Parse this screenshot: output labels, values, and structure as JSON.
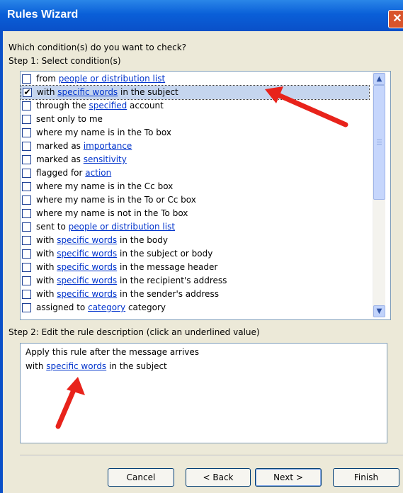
{
  "window": {
    "title": "Rules Wizard",
    "close_glyph": "✕"
  },
  "question": "Which condition(s) do you want to check?",
  "step1_label": "Step 1: Select condition(s)",
  "conditions": [
    {
      "checked": false,
      "prefix": "from ",
      "link": "people or distribution list",
      "suffix": ""
    },
    {
      "checked": true,
      "prefix": "with ",
      "link": "specific words",
      "suffix": " in the subject",
      "selected": true
    },
    {
      "checked": false,
      "prefix": "through the ",
      "link": "specified",
      "suffix": " account"
    },
    {
      "checked": false,
      "prefix": "sent only to me",
      "link": "",
      "suffix": ""
    },
    {
      "checked": false,
      "prefix": "where my name is in the To box",
      "link": "",
      "suffix": ""
    },
    {
      "checked": false,
      "prefix": "marked as ",
      "link": "importance",
      "suffix": ""
    },
    {
      "checked": false,
      "prefix": "marked as ",
      "link": "sensitivity",
      "suffix": ""
    },
    {
      "checked": false,
      "prefix": "flagged for ",
      "link": "action",
      "suffix": ""
    },
    {
      "checked": false,
      "prefix": "where my name is in the Cc box",
      "link": "",
      "suffix": ""
    },
    {
      "checked": false,
      "prefix": "where my name is in the To or Cc box",
      "link": "",
      "suffix": ""
    },
    {
      "checked": false,
      "prefix": "where my name is not in the To box",
      "link": "",
      "suffix": ""
    },
    {
      "checked": false,
      "prefix": "sent to ",
      "link": "people or distribution list",
      "suffix": ""
    },
    {
      "checked": false,
      "prefix": "with ",
      "link": "specific words",
      "suffix": " in the body"
    },
    {
      "checked": false,
      "prefix": "with ",
      "link": "specific words",
      "suffix": " in the subject or body"
    },
    {
      "checked": false,
      "prefix": "with ",
      "link": "specific words",
      "suffix": " in the message header"
    },
    {
      "checked": false,
      "prefix": "with ",
      "link": "specific words",
      "suffix": " in the recipient's address"
    },
    {
      "checked": false,
      "prefix": "with ",
      "link": "specific words",
      "suffix": " in the sender's address"
    },
    {
      "checked": false,
      "prefix": "assigned to ",
      "link": "category",
      "suffix": " category"
    }
  ],
  "step2_label": "Step 2: Edit the rule description (click an underlined value)",
  "description": {
    "line1": "Apply this rule after the message arrives",
    "line2_prefix": "with ",
    "line2_link": "specific words",
    "line2_suffix": " in the subject"
  },
  "buttons": {
    "cancel": "Cancel",
    "back": "< Back",
    "next": "Next >",
    "finish": "Finish"
  },
  "colors": {
    "title_bar": "#0a5fd8",
    "link": "#0033CC",
    "annotation_arrow": "#e8231b",
    "selection": "#C5D5EE"
  },
  "scrollbar": {
    "up_glyph": "▲",
    "down_glyph": "▼"
  }
}
